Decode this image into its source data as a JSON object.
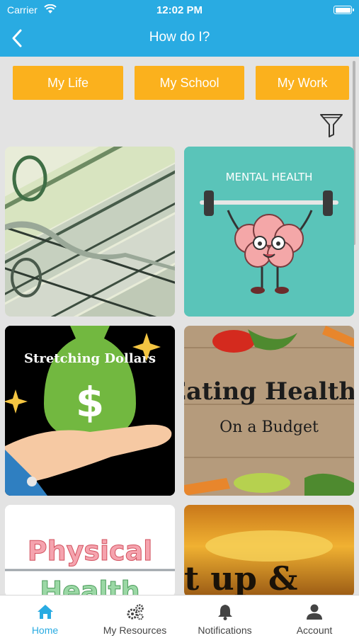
{
  "status": {
    "carrier": "Carrier",
    "time": "12:02 PM"
  },
  "header": {
    "title": "How do I?"
  },
  "tabs": [
    "My Life",
    "My School",
    "My Work"
  ],
  "cards": [
    {
      "name": "money-card"
    },
    {
      "name": "mental-health-card",
      "text": "MENTAL HEALTH"
    },
    {
      "name": "stretching-dollars-card",
      "text": "Stretching Dollars",
      "symbol": "$"
    },
    {
      "name": "eating-healthy-card",
      "line1": "Eating Healthy",
      "line2": "On a Budget"
    },
    {
      "name": "physical-health-card",
      "line1": "Physical",
      "line2": "Health"
    },
    {
      "name": "sunrise-card",
      "text": "t up &"
    }
  ],
  "bottom_nav": [
    {
      "label": "Home",
      "icon": "home-icon",
      "active": true
    },
    {
      "label": "My Resources",
      "icon": "gears-icon",
      "active": false
    },
    {
      "label": "Notifications",
      "icon": "bell-icon",
      "active": false
    },
    {
      "label": "Account",
      "icon": "person-icon",
      "active": false
    }
  ],
  "colors": {
    "brand": "#29abe2",
    "tab": "#fbb11d",
    "mental_bg": "#5ac4b9"
  }
}
